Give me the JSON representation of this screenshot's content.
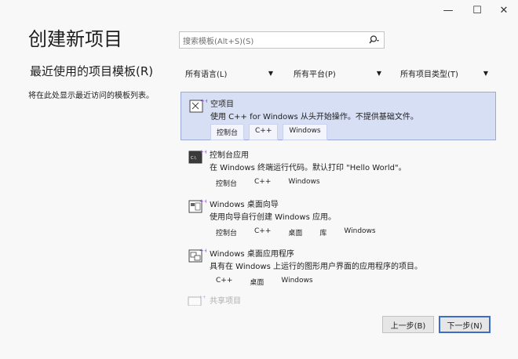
{
  "window": {
    "minimize_label": "—",
    "maximize_label": "☐",
    "close_label": "✕"
  },
  "page": {
    "title": "创建新项目"
  },
  "recent": {
    "heading": "最近使用的项目模板(R)",
    "empty_text": "将在此处显示最近访问的模板列表。"
  },
  "search": {
    "placeholder": "搜索模板(Alt+S)(S)",
    "icon": "search-icon"
  },
  "filters": {
    "language": "所有语言(L)",
    "platform": "所有平台(P)",
    "project_type": "所有项目类型(T)"
  },
  "templates": [
    {
      "title": "空项目",
      "description": "使用 C++ for Windows 从头开始操作。不提供基础文件。",
      "tags": [
        "控制台",
        "C++",
        "Windows"
      ],
      "icon": "empty-project-icon",
      "selected": true
    },
    {
      "title": "控制台应用",
      "description": "在 Windows 终端运行代码。默认打印 \"Hello World\"。",
      "tags": [
        "控制台",
        "C++",
        "Windows"
      ],
      "icon": "console-app-icon",
      "selected": false
    },
    {
      "title": "Windows 桌面向导",
      "description": "使用向导自行创建 Windows 应用。",
      "tags": [
        "控制台",
        "C++",
        "桌面",
        "库",
        "Windows"
      ],
      "icon": "desktop-wizard-icon",
      "selected": false
    },
    {
      "title": "Windows 桌面应用程序",
      "description": "具有在 Windows 上运行的图形用户界面的应用程序的项目。",
      "tags": [
        "C++",
        "桌面",
        "Windows"
      ],
      "icon": "desktop-app-icon",
      "selected": false
    }
  ],
  "shared_item": {
    "title": "共享项目",
    "icon": "shared-project-icon"
  },
  "buttons": {
    "back": "上一步(B)",
    "next": "下一步(N)"
  },
  "colors": {
    "selected_bg": "#d7dff5",
    "selected_border": "#9aa9d6",
    "primary_border": "#3c6ec9",
    "icon_accent": "#7a3fc0"
  }
}
